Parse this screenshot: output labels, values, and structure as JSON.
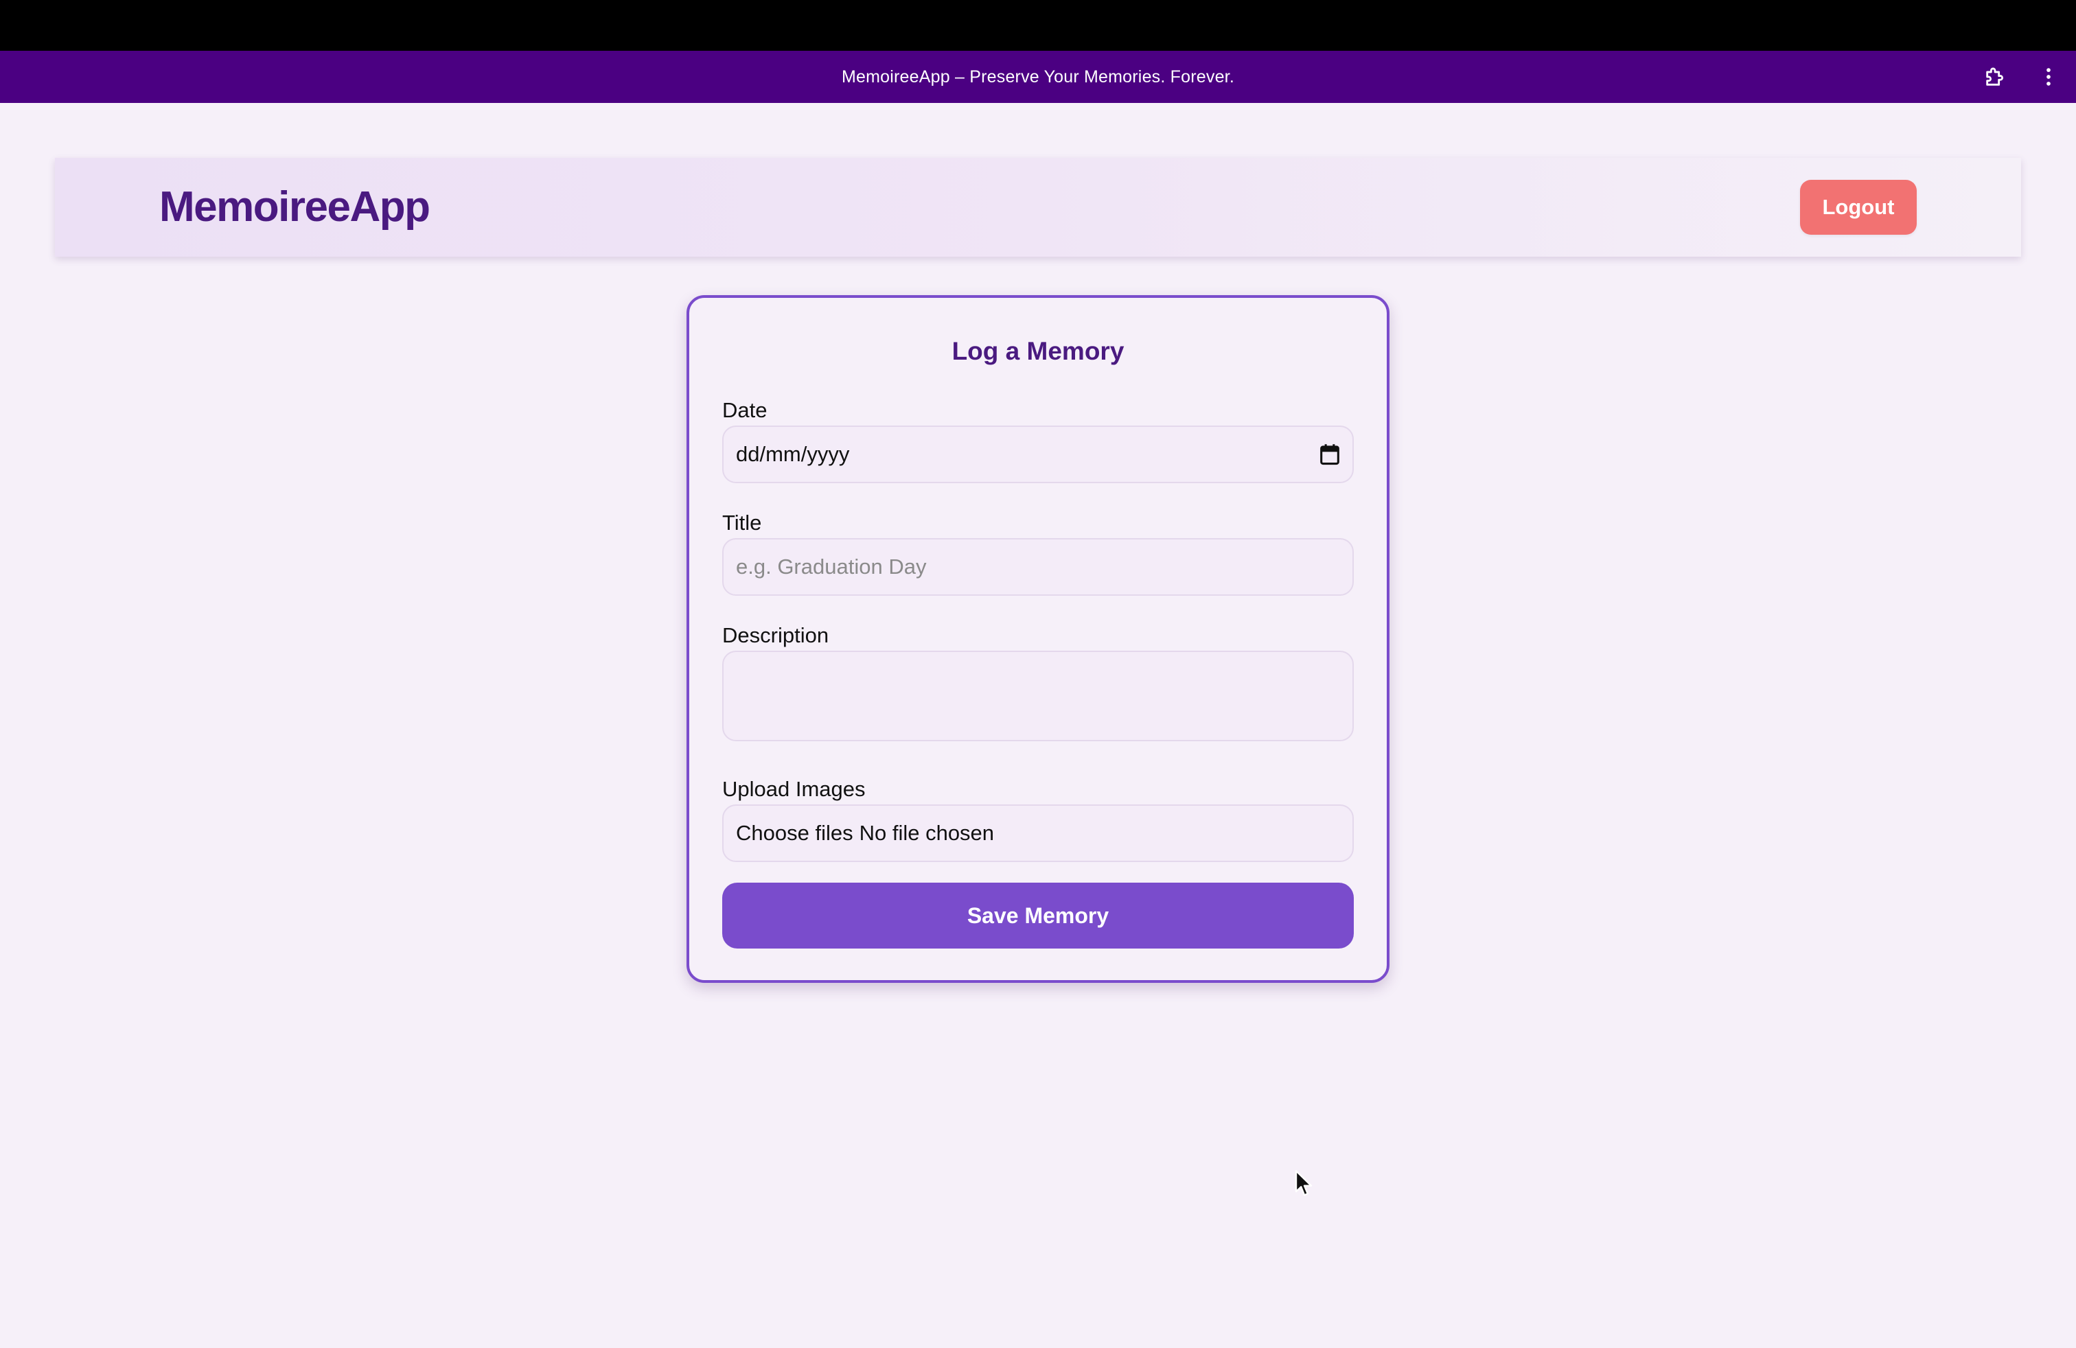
{
  "browser": {
    "app_bar_title": "MemoireeApp – Preserve Your Memories. Forever.",
    "icons": [
      "puzzle-icon",
      "kebab-menu-icon"
    ],
    "bar_color": "#4b0082"
  },
  "header": {
    "brand": "MemoireeApp",
    "logout_label": "Logout",
    "logout_color": "#f27272"
  },
  "form": {
    "title": "Log a Memory",
    "date": {
      "label": "Date",
      "value": "dd/mm/yyyy",
      "icon": "calendar-icon"
    },
    "title_field": {
      "label": "Title",
      "placeholder": "e.g. Graduation Day",
      "value": ""
    },
    "description": {
      "label": "Description",
      "value": ""
    },
    "upload": {
      "label": "Upload Images",
      "button_label": "Choose files",
      "status": "No file chosen"
    },
    "save_label": "Save Memory",
    "accent_color": "#7a4ccc",
    "heading_color": "#4a1a80"
  }
}
